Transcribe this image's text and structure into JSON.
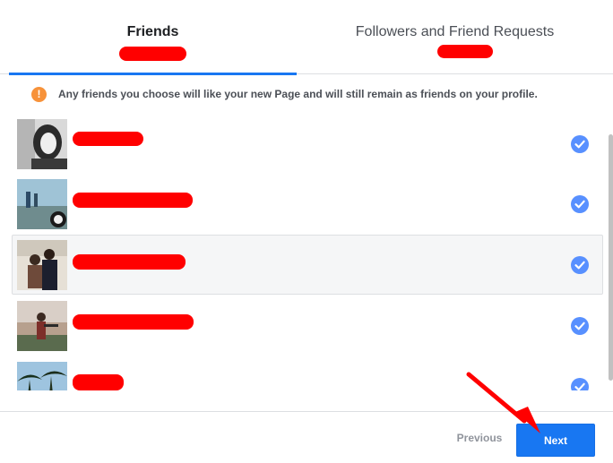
{
  "tabs": {
    "friends_label": "Friends",
    "followers_label": "Followers and Friend Requests"
  },
  "notice": {
    "icon": "info-icon",
    "icon_glyph": "!",
    "text": "Any friends you choose will like your new Page and will still remain as friends on your profile."
  },
  "friends": [
    {
      "selected": true,
      "highlighted": false
    },
    {
      "selected": true,
      "highlighted": false
    },
    {
      "selected": true,
      "highlighted": true
    },
    {
      "selected": true,
      "highlighted": false
    },
    {
      "selected": true,
      "highlighted": false
    }
  ],
  "footer": {
    "previous_label": "Previous",
    "next_label": "Next"
  },
  "colors": {
    "accent": "#1877f2",
    "check": "#5890ff",
    "info": "#f7923a",
    "annotation": "#ff0000"
  }
}
